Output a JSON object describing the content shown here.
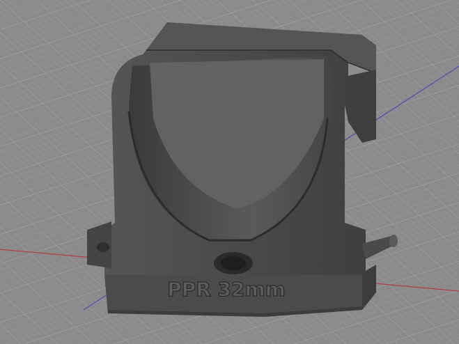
{
  "viewport": {
    "background_color": "#8a8a8a",
    "grid_color": "#9a9a9a",
    "axis_x_color": "#b04040",
    "axis_y_color": "#4a4ab8"
  },
  "model": {
    "body_color": "#4b4b4b",
    "shadow_color": "#3a3a3a",
    "highlight_color": "#6e6e6e",
    "embossed_text": "PPR 32mm"
  }
}
